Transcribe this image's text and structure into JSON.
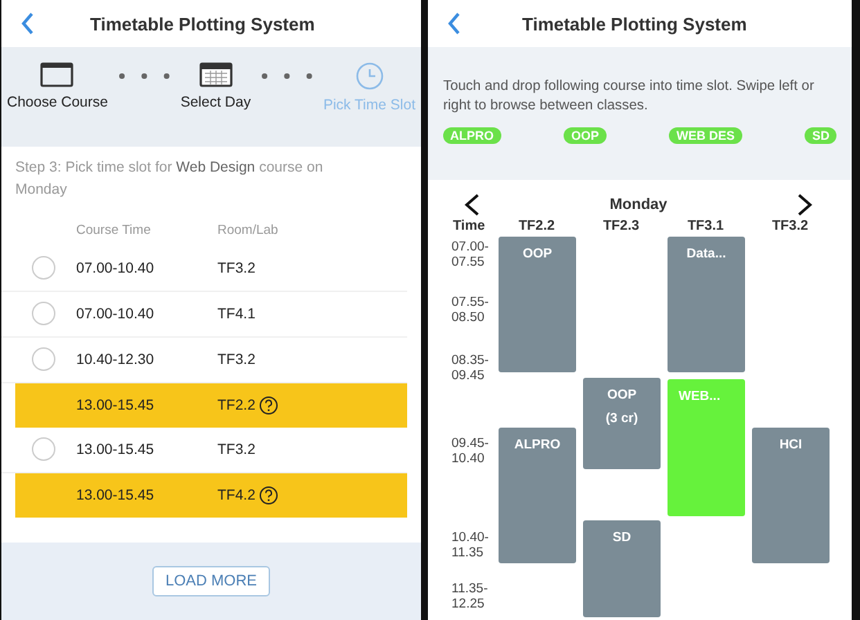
{
  "left_screen": {
    "title": "Timetable Plotting System",
    "steps": [
      {
        "label": "Choose Course",
        "kind": "course",
        "active": false
      },
      {
        "label": "Select Day",
        "kind": "calendar",
        "active": false
      },
      {
        "label": "Pick Time Slot",
        "kind": "clock",
        "active": true
      }
    ],
    "instruction": "Step 3: Pick time slot for **Web Design** course on Monday",
    "table": {
      "columns": [
        "Course Time",
        "Room/Lab"
      ],
      "rows": [
        {
          "time": "07.00-10.40",
          "room": "TF3.2",
          "selected": false
        },
        {
          "time": "07.00-10.40",
          "room": "TF4.1",
          "selected": false
        },
        {
          "time": "10.40-12.30",
          "room": "TF3.2",
          "selected": false
        },
        {
          "time": "13.00-15.45",
          "room": "TF2.2",
          "selected": true
        },
        {
          "time": "13.00-15.45",
          "room": "TF3.2",
          "selected": false
        },
        {
          "time": "13.00-15.45",
          "room": "TF4.2",
          "selected": true
        }
      ]
    },
    "load_more": "LOAD MORE"
  },
  "right_screen": {
    "title": "Timetable Plotting System",
    "instruction": "Touch and drop following course into time slot. Swipe left or right to browse between classes.",
    "courses": [
      "ALPRO",
      "OOP",
      "WEB DES",
      "SD"
    ],
    "day": "Monday",
    "time_heading": "Time",
    "rooms": [
      "TF2.2",
      "TF2.3",
      "TF3.1",
      "TF3.2"
    ],
    "times": [
      "07.00-\n07.55",
      "07.55-\n08.50",
      "08.35-\n09.45",
      "09.45-\n10.40",
      "10.40-\n11.35",
      "11.35-\n12.25"
    ],
    "blocks": [
      {
        "label": "OOP",
        "highlighted": false
      },
      {
        "label": "Data...",
        "highlighted": false
      },
      {
        "label": "OOP\n(3 cr)",
        "highlighted": false
      },
      {
        "label": "WEB...",
        "highlighted": true
      },
      {
        "label": "ALPRO",
        "highlighted": false
      },
      {
        "label": "HCI",
        "highlighted": false
      },
      {
        "label": "SD",
        "highlighted": false
      }
    ]
  }
}
